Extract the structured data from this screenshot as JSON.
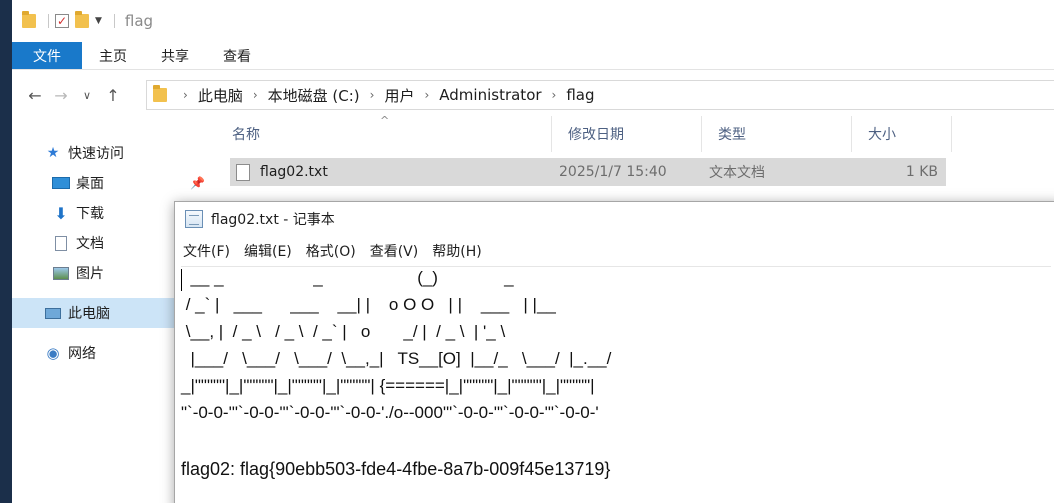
{
  "explorer": {
    "title": "flag",
    "ribbon_tabs": [
      "文件",
      "主页",
      "共享",
      "查看"
    ],
    "breadcrumb": [
      "此电脑",
      "本地磁盘 (C:)",
      "用户",
      "Administrator",
      "flag"
    ],
    "sidebar": {
      "quick_access": "快速访问",
      "desktop": "桌面",
      "downloads": "下载",
      "documents": "文档",
      "pictures": "图片",
      "this_pc": "此电脑",
      "network": "网络"
    },
    "columns": {
      "name": "名称",
      "modified": "修改日期",
      "type": "类型",
      "size": "大小"
    },
    "file": {
      "name": "flag02.txt",
      "modified": "2025/1/7 15:40",
      "type": "文本文档",
      "size": "1 KB"
    }
  },
  "notepad": {
    "title": "flag02.txt - 记事本",
    "menu": [
      "文件(F)",
      "编辑(E)",
      "格式(O)",
      "查看(V)",
      "帮助(H)"
    ],
    "ascii_art": [
      "  __ _                   _                    (_)              _",
      " / _` |   ___      ___    __| |    o O O   | |    ___   | |__",
      " \\__, |  / _ \\   / _ \\  / _` |   o       _/ |  / _ \\  | '_ \\",
      "  |___/   \\___/   \\___/  \\__,_|   TS__[O]  |__/_   \\___/  |_.__/",
      "_|\"\"\"\"\"|_|\"\"\"\"\"|_|\"\"\"\"\"|_|\"\"\"\"\"| {======|_|\"\"\"\"\"|_|\"\"\"\"\"|_|\"\"\"\"\"|",
      "\"`-0-0-'\"`-0-0-'\"`-0-0-'\"`-0-0-'./o--000'\"`-0-0-'\"`-0-0-'\"`-0-0-'"
    ],
    "flag_line": "flag02: flag{90ebb503-fde4-4fbe-8a7b-009f45e13719}"
  },
  "colors": {
    "accent": "#1979ca",
    "selected": "#cce4f7",
    "row_selected": "#d9d9d9",
    "header_text": "#4d6082"
  }
}
